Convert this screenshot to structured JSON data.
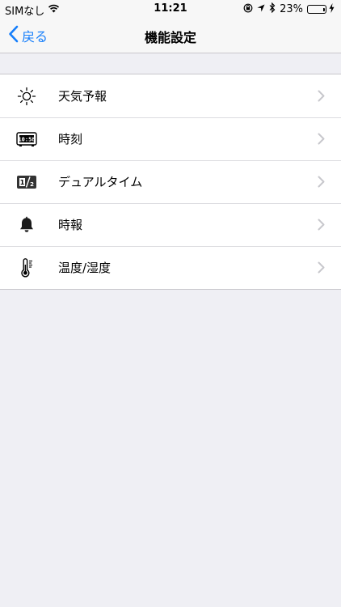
{
  "status_bar": {
    "carrier": "SIMなし",
    "time": "11:21",
    "battery_percent": "23%",
    "battery_level": 0.23,
    "icons": [
      "wifi-icon",
      "rotation-lock-icon",
      "location-icon",
      "bluetooth-icon",
      "battery-icon",
      "charging-icon"
    ]
  },
  "nav": {
    "back_label": "戻る",
    "title": "機能設定"
  },
  "menu": {
    "items": [
      {
        "label": "天気予報",
        "icon": "sun-icon"
      },
      {
        "label": "時刻",
        "icon": "clock-display-icon"
      },
      {
        "label": "デュアルタイム",
        "icon": "dual-time-icon"
      },
      {
        "label": "時報",
        "icon": "bell-icon"
      },
      {
        "label": "温度/湿度",
        "icon": "thermometer-icon"
      }
    ]
  },
  "colors": {
    "accent": "#157efb",
    "background": "#efeff4",
    "battery": "#4cd964"
  }
}
